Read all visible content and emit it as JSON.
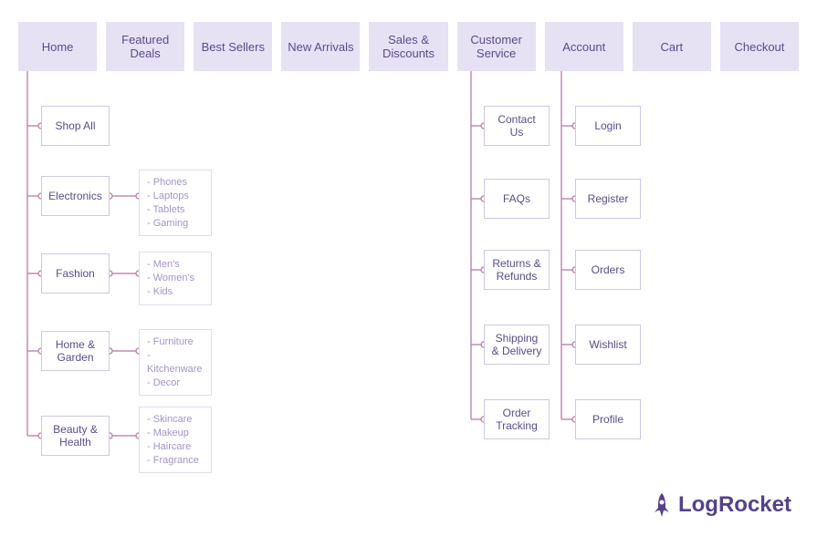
{
  "nav": [
    {
      "label": "Home"
    },
    {
      "label": "Featured Deals"
    },
    {
      "label": "Best Sellers"
    },
    {
      "label": "New Arrivals"
    },
    {
      "label": "Sales & Discounts"
    },
    {
      "label": "Customer Service"
    },
    {
      "label": "Account"
    },
    {
      "label": "Cart"
    },
    {
      "label": "Checkout"
    }
  ],
  "home_children": [
    {
      "label": "Shop All",
      "sub": null
    },
    {
      "label": "Electronics",
      "sub": [
        "Phones",
        "Laptops",
        "Tablets",
        "Gaming"
      ]
    },
    {
      "label": "Fashion",
      "sub": [
        "Men's",
        "Women's",
        "Kids"
      ]
    },
    {
      "label": "Home & Garden",
      "sub": [
        "Furniture",
        "Kitchenware",
        "Decor"
      ]
    },
    {
      "label": "Beauty & Health",
      "sub": [
        "Skincare",
        "Makeup",
        "Haircare",
        "Fragrance"
      ]
    }
  ],
  "customer_children": [
    {
      "label": "Contact Us"
    },
    {
      "label": "FAQs"
    },
    {
      "label": "Returns & Refunds"
    },
    {
      "label": "Shipping & Delivery"
    },
    {
      "label": "Order Tracking"
    }
  ],
  "account_children": [
    {
      "label": "Login"
    },
    {
      "label": "Register"
    },
    {
      "label": "Orders"
    },
    {
      "label": "Wishlist"
    },
    {
      "label": "Profile"
    }
  ],
  "brand": "LogRocket"
}
